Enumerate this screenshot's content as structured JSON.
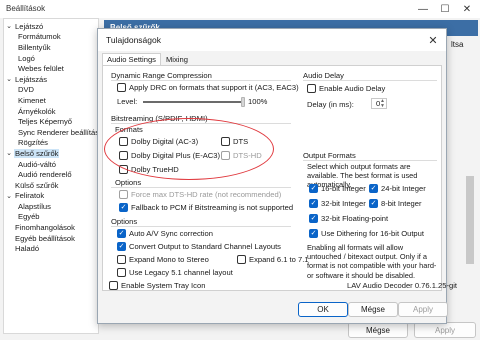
{
  "parent": {
    "title": "Beállítások",
    "heading": "Belső szűrők",
    "side_text": "ltsa",
    "buttons": {
      "ok": "OK",
      "cancel": "Mégse",
      "apply": "Apply"
    },
    "tree": [
      {
        "label": "Lejátszó",
        "level": 0,
        "toggle": "⌄"
      },
      {
        "label": "Formátumok",
        "level": 1
      },
      {
        "label": "Billentyűk",
        "level": 1
      },
      {
        "label": "Logó",
        "level": 1
      },
      {
        "label": "Webes felület",
        "level": 1
      },
      {
        "label": "Lejátszás",
        "level": 0,
        "toggle": "⌄"
      },
      {
        "label": "DVD",
        "level": 1
      },
      {
        "label": "Kimenet",
        "level": 1
      },
      {
        "label": "Árnyékolók",
        "level": 1
      },
      {
        "label": "Teljes Képernyő",
        "level": 1
      },
      {
        "label": "Sync Renderer beállítások",
        "level": 1
      },
      {
        "label": "Rögzítés",
        "level": 1
      },
      {
        "label": "Belső szűrők",
        "level": 0,
        "toggle": "⌄",
        "selected": true
      },
      {
        "label": "Audió-váltó",
        "level": 1
      },
      {
        "label": "Audió renderelő",
        "level": 1
      },
      {
        "label": "Külső szűrők",
        "level": 0
      },
      {
        "label": "Feliratok",
        "level": 0,
        "toggle": "⌄"
      },
      {
        "label": "Alapstílus",
        "level": 1
      },
      {
        "label": "Egyéb",
        "level": 1
      },
      {
        "label": "Finomhangolások",
        "level": 0
      },
      {
        "label": "Egyéb beállítások",
        "level": 0
      },
      {
        "label": "Haladó",
        "level": 0
      }
    ]
  },
  "dialog": {
    "title": "Tulajdonságok",
    "tabs": [
      "Audio Settings",
      "Mixing"
    ],
    "drc": {
      "group_title": "Dynamic Range Compression",
      "apply_label": "Apply DRC on formats that support it (AC3, EAC3)",
      "apply_checked": false,
      "level_label": "Level:",
      "level_value": "100%",
      "level_fraction": 1.0
    },
    "bitstreaming": {
      "group_title": "Bitstreaming (S/PDIF, HDMI)",
      "formats_title": "Formats",
      "formats": [
        {
          "label": "Dolby Digital (AC-3)",
          "checked": false,
          "disabled": false
        },
        {
          "label": "DTS",
          "checked": false,
          "disabled": false
        },
        {
          "label": "Dolby Digital Plus (E-AC3)",
          "checked": false,
          "disabled": false
        },
        {
          "label": "DTS-HD",
          "checked": false,
          "disabled": true
        },
        {
          "label": "Dolby TrueHD",
          "checked": false,
          "disabled": false
        }
      ],
      "options_title": "Options",
      "options": [
        {
          "label": "Force max DTS-HD rate (not recommended)",
          "checked": false,
          "disabled": true
        },
        {
          "label": "Fallback to PCM if Bitstreaming is not supported",
          "checked": true,
          "disabled": false
        }
      ]
    },
    "options": {
      "group_title": "Options",
      "items": [
        {
          "label": "Auto A/V Sync correction",
          "checked": true
        },
        {
          "label": "Convert Output to Standard Channel Layouts",
          "checked": true
        },
        {
          "label": "Expand Mono to Stereo",
          "checked": false
        },
        {
          "label": "Expand 6.1 to 7.1",
          "checked": false
        },
        {
          "label": "Use Legacy 5.1 channel layout",
          "checked": false
        }
      ]
    },
    "system_tray": {
      "label": "Enable System Tray Icon",
      "checked": false
    },
    "audio_delay": {
      "group_title": "Audio Delay",
      "enable_label": "Enable Audio Delay",
      "enable_checked": false,
      "delay_label": "Delay (in ms):",
      "delay_value": "0"
    },
    "output_formats": {
      "group_title": "Output Formats",
      "description": "Select which output formats are available. The best format is used automatically.",
      "formats": [
        {
          "label": "16-bit Integer",
          "checked": true
        },
        {
          "label": "24-bit Integer",
          "checked": true
        },
        {
          "label": "32-bit Integer",
          "checked": true
        },
        {
          "label": "8-bit Integer",
          "checked": true
        },
        {
          "label": "32-bit Floating-point",
          "checked": true
        }
      ],
      "dithering_label": "Use Dithering for 16-bit Output",
      "dithering_checked": true,
      "note": "Enabling all formats will allow untouched / bitexact output. Only if a format is not compatible with your hard- or software it should be disabled."
    },
    "version": "LAV Audio Decoder 0.76.1.25-git",
    "buttons": {
      "ok": "OK",
      "cancel": "Mégse",
      "apply": "Apply"
    },
    "colors": {
      "accent": "#0a64c8",
      "highlight": "#e0393e"
    }
  }
}
